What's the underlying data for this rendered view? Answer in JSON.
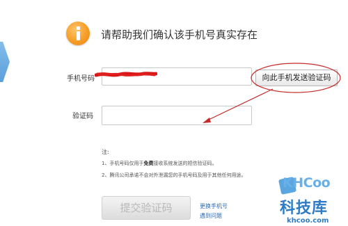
{
  "dialog": {
    "title": "请帮助我们确认该手机号真实存在",
    "icon": "info-icon",
    "phone": {
      "label": "手机号码",
      "value": ""
    },
    "send_code_button": "向此手机发送验证码",
    "code": {
      "label": "验证码",
      "value": "",
      "placeholder": ""
    },
    "notes": {
      "title": "注:",
      "item1_prefix": "1、手机号码仅用于",
      "item1_bold": "免费",
      "item1_suffix": "接收系统发送的短信验证码。",
      "item2": "2、腾讯公司承诺不会对外泄漏您的手机号码及用于其他任何用途。"
    },
    "submit_button": "提交验证码",
    "change_phone_link": "更换手机号",
    "problem_link": "遇到问题"
  },
  "watermark": {
    "logo_text": "KHCoo",
    "brand_cn": "科技库",
    "url": "khcoo.com"
  },
  "colors": {
    "accent_orange": "#f59a22",
    "annotation_red": "#d21a1a",
    "link_blue": "#2a6ab5",
    "watermark_blue": "#2f7cc4"
  }
}
